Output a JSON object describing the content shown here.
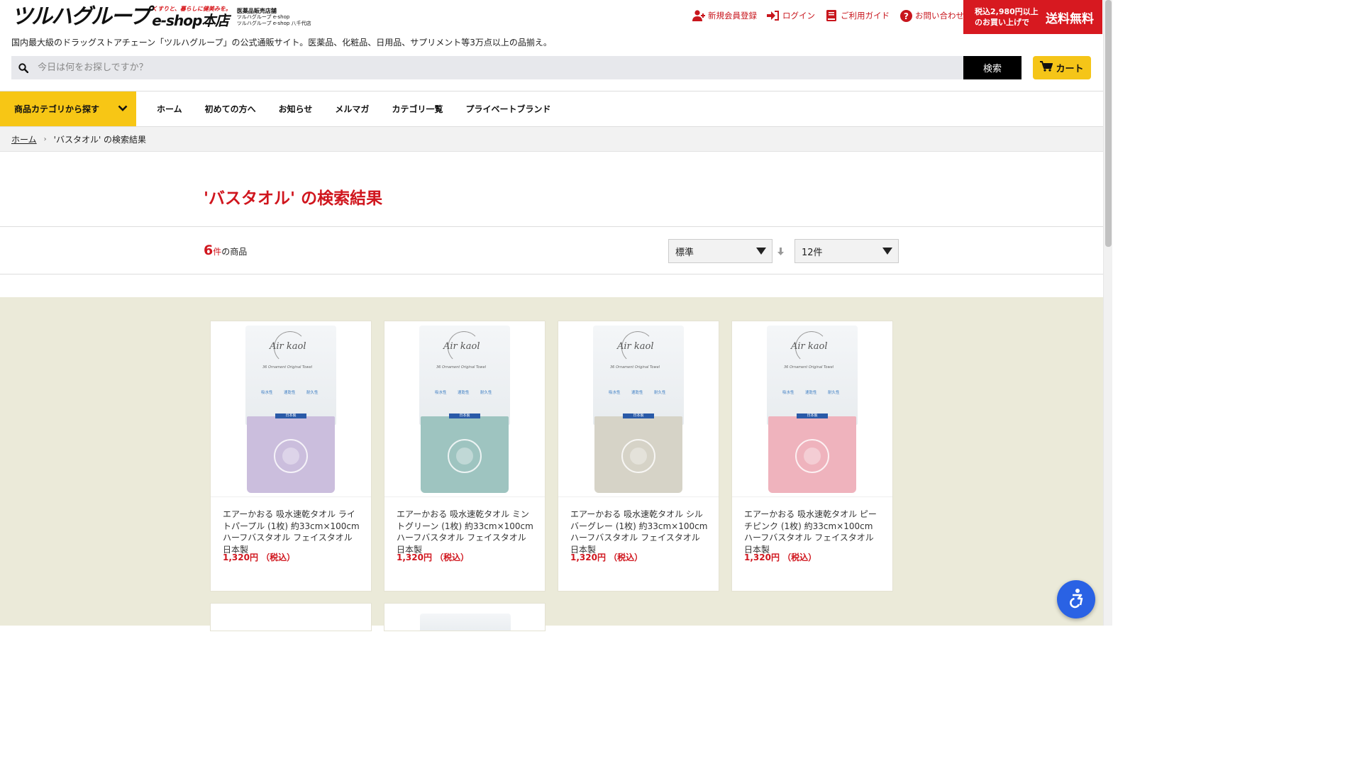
{
  "logo": {
    "main": "ツルハグループ",
    "tagline_small": "くすりと、暮らしに健美みを。",
    "eshop": "e-shop本店",
    "license": "医薬品販売店舗",
    "store1": "ツルハグループ e-shop",
    "store2": "ツルハグループ e-shop 八千代店"
  },
  "site_tagline": "国内最大級のドラッグストアチェーン「ツルハグループ」の公式通販サイト。医薬品、化粧品、日用品、サプリメント等3万点以上の品揃え。",
  "toplinks": [
    {
      "label": "新規会員登録",
      "icon": "user-add-icon"
    },
    {
      "label": "ログイン",
      "icon": "login-icon"
    },
    {
      "label": "ご利用ガイド",
      "icon": "guide-icon"
    },
    {
      "label": "お問い合わせ",
      "icon": "help-icon"
    }
  ],
  "shipping": {
    "small": "税込2,980円以上のお買い上げで",
    "big": "送料無料"
  },
  "search": {
    "placeholder": "今日は何をお探しですか？",
    "button": "検索"
  },
  "cart": {
    "label": "カート"
  },
  "nav": {
    "category_button": "商品カテゴリから探す",
    "links": [
      "ホーム",
      "初めての方へ",
      "お知らせ",
      "メルマガ",
      "カテゴリ一覧",
      "プライベートブランド"
    ]
  },
  "breadcrumb": {
    "home": "ホーム",
    "current": "'バスタオル' の検索結果"
  },
  "page_title": "'バスタオル' の検索結果",
  "results": {
    "count": "6",
    "unit": "件",
    "suffix": "の商品",
    "sort": "標準",
    "per_page": "12件"
  },
  "products": [
    {
      "name": "エアーかおる 吸水速乾タオル ライトパープル (1枚) 約33cm×100cm ハーフバスタオル フェイスタオル 日本製",
      "price": "1,320円 （税込）",
      "color": "#cbbedd"
    },
    {
      "name": "エアーかおる 吸水速乾タオル ミントグリーン (1枚) 約33cm×100cm ハーフバスタオル フェイスタオル 日本製",
      "price": "1,320円 （税込）",
      "color": "#9ec4c0"
    },
    {
      "name": "エアーかおる 吸水速乾タオル シルバーグレー (1枚) 約33cm×100cm ハーフバスタオル フェイスタオル 日本製",
      "price": "1,320円 （税込）",
      "color": "#d6d3c7"
    },
    {
      "name": "エアーかおる 吸水速乾タオル ピーチピンク (1枚) 約33cm×100cm ハーフバスタオル フェイスタオル 日本製",
      "price": "1,320円 （税込）",
      "color": "#efb3bd"
    }
  ],
  "package": {
    "brand": "Air kaol",
    "sub": "36 Ornament Original Towel",
    "features": [
      "吸水性",
      "速乾性",
      "耐久性"
    ],
    "made_in": "日本製"
  },
  "colors": {
    "accent_red": "#d0161e",
    "nav_yellow": "#f7c615",
    "product_bg": "#ebead9"
  }
}
